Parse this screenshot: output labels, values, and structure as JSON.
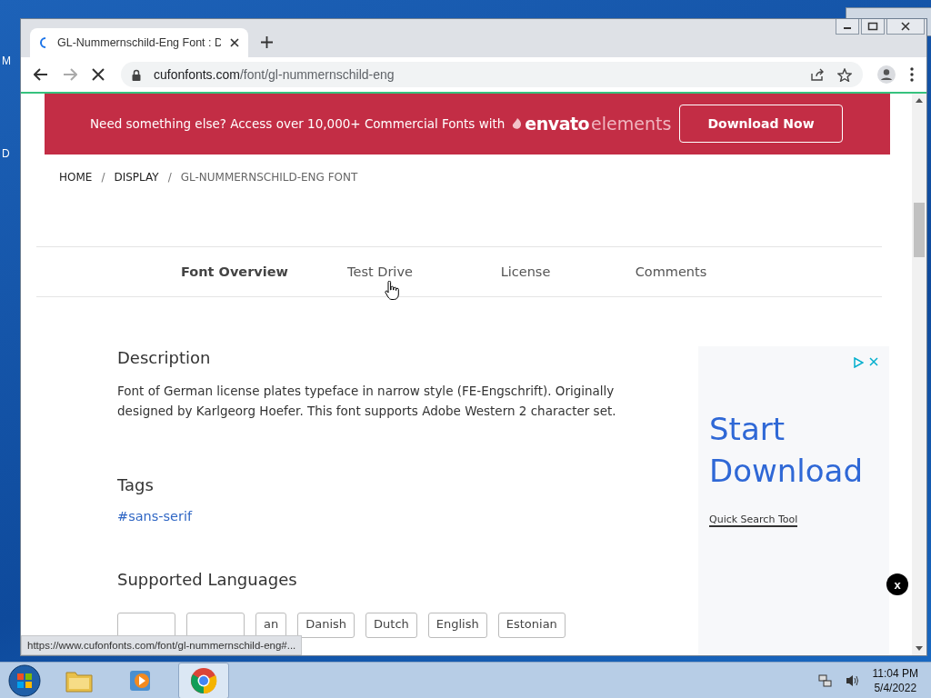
{
  "desktop": {
    "icon_labels": [
      "M",
      "D"
    ]
  },
  "browser": {
    "tab": {
      "title": "GL-Nummernschild-Eng Font : D",
      "loading": true
    },
    "url": {
      "host": "cufonfonts.com",
      "path": "/font/gl-nummernschild-eng"
    },
    "forward_disabled": true
  },
  "banner": {
    "text": "Need something else? Access over 10,000+ Commercial Fonts with",
    "brand_main": "envato",
    "brand_sub": "elements",
    "button": "Download Now"
  },
  "breadcrumb_separator": "/",
  "breadcrumb": [
    {
      "label": "HOME",
      "current": false
    },
    {
      "label": "DISPLAY",
      "current": false
    },
    {
      "label": "GL-NUMMERNSCHILD-ENG FONT",
      "current": true
    }
  ],
  "tabs": [
    {
      "label": "Font Overview",
      "selected": true
    },
    {
      "label": "Test Drive",
      "selected": false
    },
    {
      "label": "License",
      "selected": false
    },
    {
      "label": "Comments",
      "selected": false
    }
  ],
  "description": {
    "heading": "Description",
    "text": "Font of German license plates typeface in narrow style (FE-Engschrift). Originally designed by Karlgeorg Hoefer. This font supports Adobe Western 2 character set."
  },
  "tags": {
    "heading": "Tags",
    "items": [
      "#sans-serif"
    ]
  },
  "languages": {
    "heading": "Supported Languages",
    "items": [
      {
        "kind": "covered"
      },
      {
        "kind": "covered"
      },
      {
        "kind": "tag",
        "label": "an"
      },
      {
        "kind": "tag",
        "label": "Danish"
      },
      {
        "kind": "tag",
        "label": "Dutch"
      },
      {
        "kind": "tag",
        "label": "English"
      },
      {
        "kind": "tag",
        "label": "Estonian"
      }
    ]
  },
  "ad": {
    "headline": "Start Download",
    "link": "Quick Search Tool",
    "close": "x"
  },
  "status_url": "https://www.cufonfonts.com/font/gl-nummernschild-eng#...",
  "taskbar": {
    "time": "11:04 PM",
    "date": "5/4/2022"
  }
}
